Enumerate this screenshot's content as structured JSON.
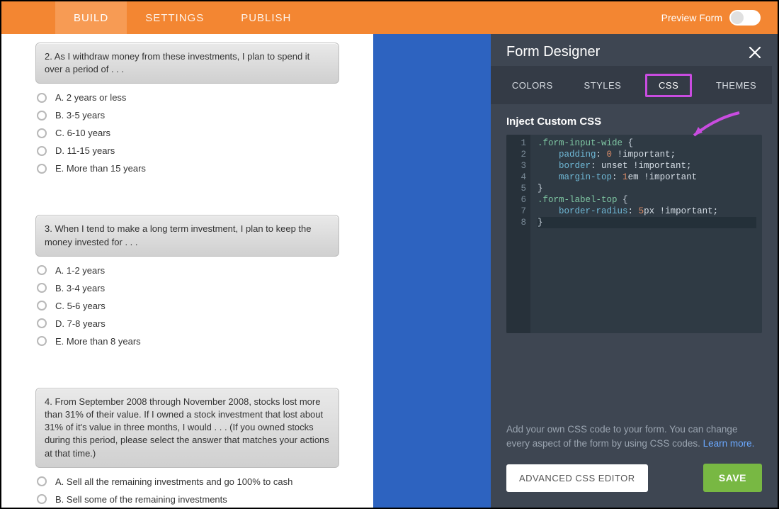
{
  "topbar": {
    "tabs": [
      "BUILD",
      "SETTINGS",
      "PUBLISH"
    ],
    "active_index": 0,
    "preview_label": "Preview Form"
  },
  "questions": [
    {
      "title": "2. As I withdraw money from these investments, I plan to spend it over a period of . . .",
      "options": [
        "A. 2 years or less",
        "B. 3-5 years",
        "C. 6-10 years",
        "D. 11-15 years",
        "E. More than 15 years"
      ]
    },
    {
      "title": "3. When I tend to make a long term investment, I plan to keep the money invested for . . .",
      "options": [
        "A. 1-2 years",
        "B. 3-4 years",
        "C. 5-6 years",
        "D. 7-8 years",
        "E. More than 8 years"
      ]
    },
    {
      "title": "4. From September 2008 through November 2008, stocks lost more than 31% of their value. If I owned a stock investment that lost about 31% of it's value in three months, I would . . .  (If you owned stocks during this period, please select the answer that matches your actions at that time.)",
      "options": [
        "A. Sell all the remaining investments and go 100% to cash",
        "B. Sell some of the remaining investments"
      ]
    }
  ],
  "panel": {
    "title": "Form Designer",
    "tabs": [
      "COLORS",
      "STYLES",
      "CSS",
      "THEMES"
    ],
    "active_index": 2,
    "inject_label": "Inject Custom CSS",
    "hint_text": "Add your own CSS code to your form. You can change every aspect of the form by using CSS codes. ",
    "hint_link": "Learn more.",
    "advanced_label": "ADVANCED CSS EDITOR",
    "save_label": "SAVE",
    "code": {
      "lines": 8,
      "tokens": [
        [
          ".form-input-wide",
          " {"
        ],
        [
          "    ",
          "padding",
          ": ",
          "0",
          " !important;"
        ],
        [
          "    ",
          "border",
          ": unset !important;"
        ],
        [
          "    ",
          "margin-top",
          ": ",
          "1",
          "em !important"
        ],
        [
          "}"
        ],
        [
          ".form-label-top",
          " {"
        ],
        [
          "    ",
          "border-radius",
          ": ",
          "5",
          "px !important;"
        ],
        [
          "}"
        ]
      ]
    }
  }
}
